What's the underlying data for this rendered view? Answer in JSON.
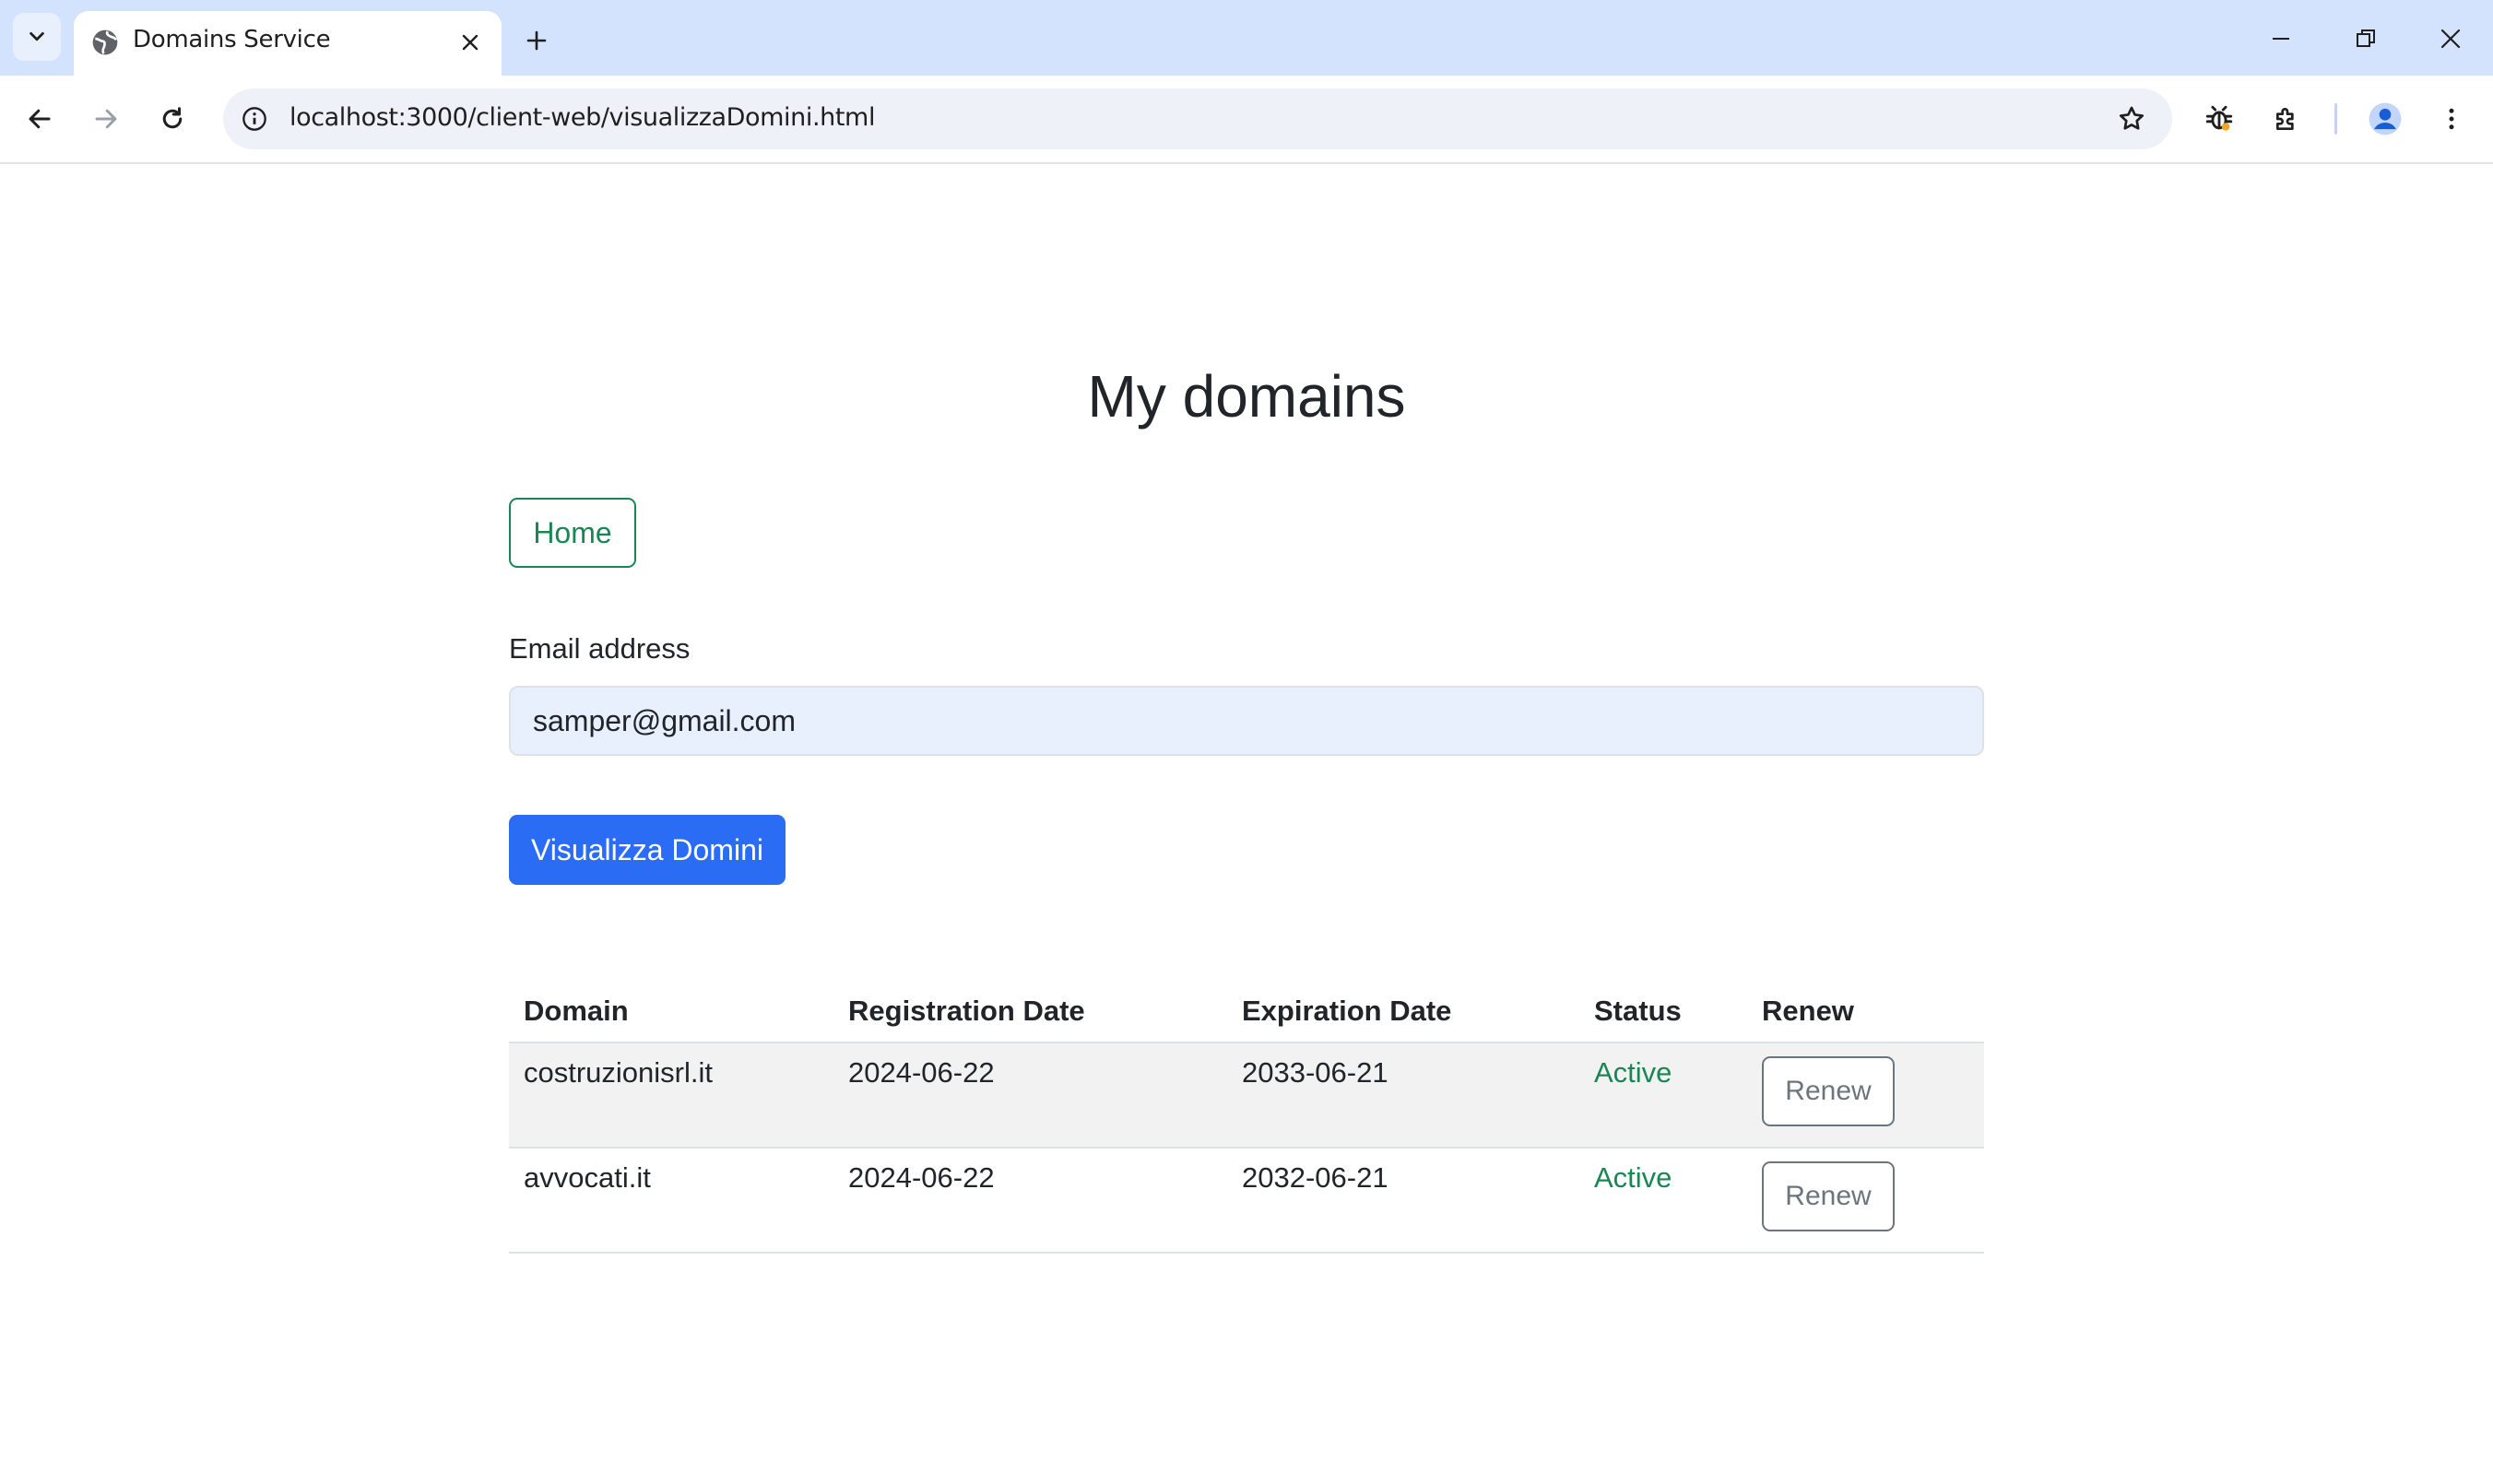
{
  "browser": {
    "tab_title": "Domains Service",
    "url": "localhost:3000/client-web/visualizzaDomini.html"
  },
  "page": {
    "title": "My domains",
    "home_label": "Home",
    "email_label": "Email address",
    "email_value": "samper@gmail.com",
    "submit_label": "Visualizza Domini"
  },
  "table": {
    "headers": [
      "Domain",
      "Registration Date",
      "Expiration Date",
      "Status",
      "Renew"
    ],
    "rows": [
      {
        "domain": "costruzionisrl.it",
        "registration": "2024-06-22",
        "expiration": "2033-06-21",
        "status": "Active",
        "renew": "Renew"
      },
      {
        "domain": "avvocati.it",
        "registration": "2024-06-22",
        "expiration": "2032-06-21",
        "status": "Active",
        "renew": "Renew"
      }
    ]
  },
  "colors": {
    "primary": "#2b6cf5",
    "success": "#198754",
    "secondary": "#6c757d",
    "tabbar": "#d3e3fd"
  }
}
